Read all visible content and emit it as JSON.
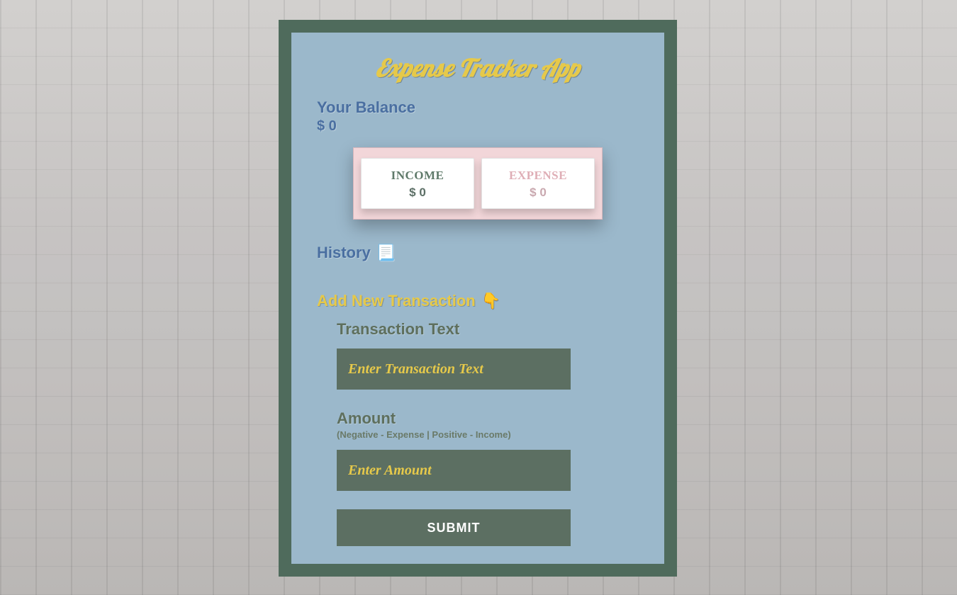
{
  "app": {
    "title": "Expense Tracker App"
  },
  "balance": {
    "label": "Your Balance",
    "amount": "$ 0"
  },
  "summary": {
    "income": {
      "label": "INCOME",
      "value": "$ 0"
    },
    "expense": {
      "label": "EXPENSE",
      "value": "$ 0"
    }
  },
  "history": {
    "heading": "History",
    "icon": "📃"
  },
  "add": {
    "heading": "Add New Transaction",
    "icon": "👇",
    "text_label": "Transaction Text",
    "text_placeholder": "Enter Transaction Text",
    "amount_label": "Amount",
    "amount_sub": "(Negative - Expense | Positive - Income)",
    "amount_placeholder": "Enter Amount",
    "submit_label": "SUBMIT"
  }
}
